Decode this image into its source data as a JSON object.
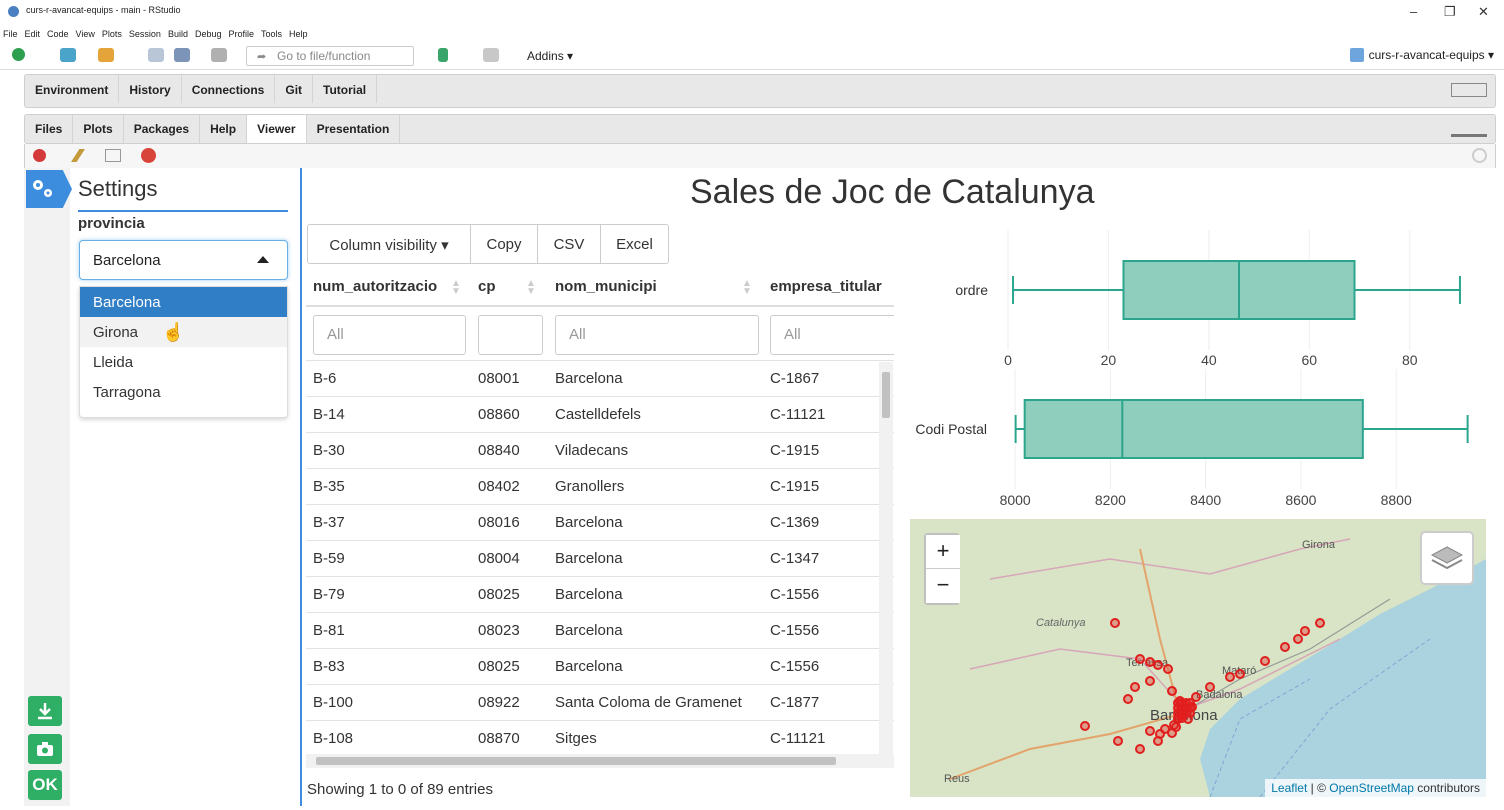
{
  "window": {
    "title": "curs-r-avancat-equips - main - RStudio",
    "min": "–",
    "max": "❐",
    "close": "✕"
  },
  "menu": [
    "File",
    "Edit",
    "Code",
    "View",
    "Plots",
    "Session",
    "Build",
    "Debug",
    "Profile",
    "Tools",
    "Help"
  ],
  "toolbar": {
    "goto_placeholder": "Go to file/function",
    "addins": "Addins ▾",
    "project": "curs-r-avancat-equips ▾"
  },
  "top_pane_tabs": [
    "Environment",
    "History",
    "Connections",
    "Git",
    "Tutorial"
  ],
  "bottom_pane_tabs": [
    "Files",
    "Plots",
    "Packages",
    "Help",
    "Viewer",
    "Presentation"
  ],
  "active_bottom_tab": "Viewer",
  "app": {
    "settings_title": "Settings",
    "provincia_label": "provincia",
    "provincia_value": "Barcelona",
    "options": [
      "Barcelona",
      "Girona",
      "Lleida",
      "Tarragona"
    ],
    "title": "Sales de Joc de Catalunya",
    "buttons": [
      "Column visibility ▾",
      "Copy",
      "CSV",
      "Excel"
    ],
    "sidebar_ok": "OK"
  },
  "table": {
    "columns": [
      "num_autoritzacio",
      "cp",
      "nom_municipi",
      "empresa_titular"
    ],
    "filter_placeholder": "All",
    "rows": [
      [
        "B-6",
        "08001",
        "Barcelona",
        "C-1867"
      ],
      [
        "B-14",
        "08860",
        "Castelldefels",
        "C-11121"
      ],
      [
        "B-30",
        "08840",
        "Viladecans",
        "C-1915"
      ],
      [
        "B-35",
        "08402",
        "Granollers",
        "C-1915"
      ],
      [
        "B-37",
        "08016",
        "Barcelona",
        "C-1369"
      ],
      [
        "B-59",
        "08004",
        "Barcelona",
        "C-1347"
      ],
      [
        "B-79",
        "08025",
        "Barcelona",
        "C-1556"
      ],
      [
        "B-81",
        "08023",
        "Barcelona",
        "C-1556"
      ],
      [
        "B-83",
        "08025",
        "Barcelona",
        "C-1556"
      ],
      [
        "B-100",
        "08922",
        "Santa Coloma de Gramenet",
        "C-1877"
      ],
      [
        "B-108",
        "08870",
        "Sitges",
        "C-11121"
      ]
    ],
    "info": "Showing 1 to 0 of 89 entries"
  },
  "chart_data": [
    {
      "type": "box",
      "category": "ordre",
      "min": 1,
      "q1": 23,
      "median": 46,
      "q3": 69,
      "max": 90,
      "ticks": [
        0,
        20,
        40,
        60,
        80
      ],
      "xlim": [
        0,
        92
      ],
      "color": "#2ca58d"
    },
    {
      "type": "box",
      "category": "Codi Postal",
      "min": 8001,
      "q1": 8020,
      "median": 8225,
      "q3": 8730,
      "max": 8950,
      "ticks": [
        8000,
        8200,
        8400,
        8600,
        8800
      ],
      "xlim": [
        7985,
        8955
      ],
      "color": "#2ca58d"
    }
  ],
  "map": {
    "zoom_in": "+",
    "zoom_out": "−",
    "labels": [
      "Girona",
      "Catalunya",
      "Terrassa",
      "Mataró",
      "Badalona",
      "Barcelona",
      "Reus"
    ],
    "attribution_leaflet": "Leaflet",
    "attribution_sep": " | © ",
    "attribution_osm": "OpenStreetMap",
    "attribution_tail": " contributors"
  }
}
